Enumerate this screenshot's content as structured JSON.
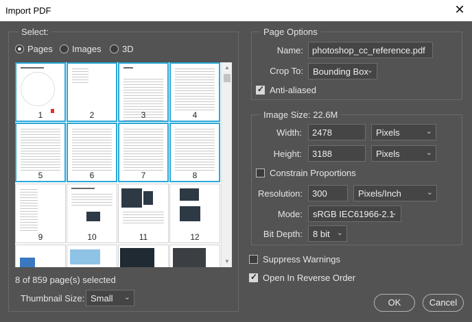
{
  "window": {
    "title": "Import PDF"
  },
  "select": {
    "legend": "Select:",
    "options": [
      {
        "label": "Pages",
        "checked": true
      },
      {
        "label": "Images",
        "checked": false
      },
      {
        "label": "3D",
        "checked": false
      }
    ],
    "pages": [
      {
        "num": "1",
        "selected": true
      },
      {
        "num": "2",
        "selected": true
      },
      {
        "num": "3",
        "selected": true
      },
      {
        "num": "4",
        "selected": true
      },
      {
        "num": "5",
        "selected": true
      },
      {
        "num": "6",
        "selected": true
      },
      {
        "num": "7",
        "selected": true
      },
      {
        "num": "8",
        "selected": true
      },
      {
        "num": "9",
        "selected": false
      },
      {
        "num": "10",
        "selected": false
      },
      {
        "num": "11",
        "selected": false
      },
      {
        "num": "12",
        "selected": false
      }
    ],
    "status": "8 of 859 page(s) selected",
    "thumbnail_size_label": "Thumbnail Size:",
    "thumbnail_size_value": "Small"
  },
  "page_options": {
    "legend": "Page Options",
    "name_label": "Name:",
    "name_value": "photoshop_cc_reference.pdf",
    "crop_label": "Crop To:",
    "crop_value": "Bounding Box",
    "anti_aliased_label": "Anti-aliased",
    "anti_aliased_checked": true
  },
  "image_size": {
    "legend": "Image Size: 22.6M",
    "width_label": "Width:",
    "width_value": "2478",
    "width_unit": "Pixels",
    "height_label": "Height:",
    "height_value": "3188",
    "height_unit": "Pixels",
    "constrain_label": "Constrain Proportions",
    "constrain_checked": false,
    "resolution_label": "Resolution:",
    "resolution_value": "300",
    "resolution_unit": "Pixels/Inch",
    "mode_label": "Mode:",
    "mode_value": "sRGB IEC61966-2.1",
    "bitdepth_label": "Bit Depth:",
    "bitdepth_value": "8 bit"
  },
  "options": {
    "suppress_warnings_label": "Suppress Warnings",
    "suppress_warnings_checked": false,
    "reverse_order_label": "Open In Reverse Order",
    "reverse_order_checked": true
  },
  "buttons": {
    "ok": "OK",
    "cancel": "Cancel"
  },
  "colors": {
    "background": "#535353",
    "selection": "#29a7d8",
    "titlebar": "#ffffff"
  }
}
